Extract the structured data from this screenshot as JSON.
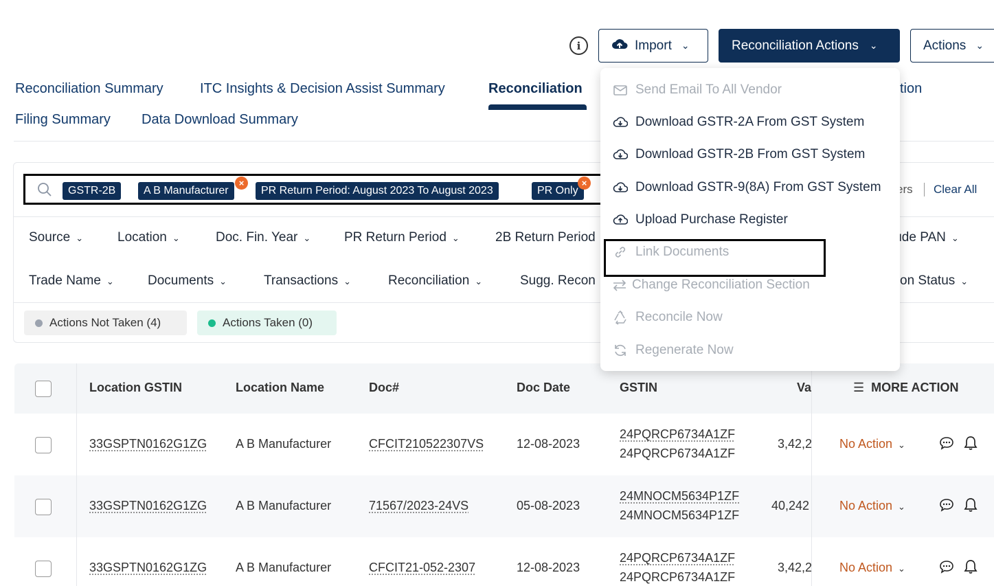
{
  "toolbar": {
    "info_glyph": "i",
    "import_label": "Import",
    "recon_actions_label": "Reconciliation Actions",
    "actions_label": "Actions"
  },
  "tabs": [
    {
      "label": "Reconciliation Summary"
    },
    {
      "label": "ITC Insights & Decision Assist Summary"
    },
    {
      "label": "Reconciliation",
      "active": true
    },
    {
      "label": "tion"
    },
    {
      "label": "Filing Summary"
    },
    {
      "label": "Data Download Summary"
    }
  ],
  "filters": {
    "chips": [
      "GSTR-2B",
      "A B Manufacturer",
      "PR Return Period: August 2023 To August 2023",
      "PR Only"
    ],
    "chip_remove_glyph": "×",
    "ers_text": "ers",
    "clear_all": "Clear All",
    "row1": [
      "Source",
      "Location",
      "Doc. Fin. Year",
      "PR Return Period",
      "2B Return Period",
      "lude PAN"
    ],
    "row2": [
      "Trade Name",
      "Documents",
      "Transactions",
      "Reconciliation",
      "Sugg. Recon",
      "on Status"
    ]
  },
  "action_pills": {
    "not_taken": "Actions Not Taken (4)",
    "taken": "Actions Taken (0)"
  },
  "table": {
    "headers": {
      "location_gstin": "Location GSTIN",
      "location_name": "Location Name",
      "doc_no": "Doc#",
      "doc_date": "Doc Date",
      "gstin": "GSTIN",
      "value": "Va",
      "more_action": "MORE ACTION"
    },
    "rows": [
      {
        "location_gstin": "33GSPTN0162G1ZG",
        "location_name": "A B Manufacturer",
        "doc_no": "CFCIT210522307VS",
        "doc_date": "12-08-2023",
        "gstin_1": "24PQRCP6734A1ZF",
        "gstin_2": "24PQRCP6734A1ZF",
        "value": "3,42,2",
        "action": "No Action"
      },
      {
        "location_gstin": "33GSPTN0162G1ZG",
        "location_name": "A B Manufacturer",
        "doc_no": "71567/2023-24VS",
        "doc_date": "05-08-2023",
        "gstin_1": "24MNOCM5634P1ZF",
        "gstin_2": "24MNOCM5634P1ZF",
        "value": "40,242",
        "action": "No Action"
      },
      {
        "location_gstin": "33GSPTN0162G1ZG",
        "location_name": "A B Manufacturer",
        "doc_no": "CFCIT21-052-2307",
        "doc_date": "12-08-2023",
        "gstin_1": "24PQRCP6734A1ZF",
        "gstin_2": "24PQRCP6734A1ZF",
        "value": "3,42,2",
        "action": "No Action"
      }
    ]
  },
  "menu": {
    "items": [
      {
        "label": "Send Email To All Vendor",
        "icon": "mail-icon",
        "enabled": false
      },
      {
        "label": "Download GSTR-2A From GST System",
        "icon": "cloud-download-icon",
        "enabled": true
      },
      {
        "label": "Download GSTR-2B From GST System",
        "icon": "cloud-download-icon",
        "enabled": true
      },
      {
        "label": "Download GSTR-9(8A) From GST System",
        "icon": "cloud-download-icon",
        "enabled": true
      },
      {
        "label": "Upload Purchase Register",
        "icon": "cloud-upload-icon",
        "enabled": true
      },
      {
        "label": "Link Documents",
        "icon": "link-icon",
        "enabled": false
      },
      {
        "label": "Change Reconciliation Section",
        "icon": "swap-icon",
        "enabled": false
      },
      {
        "label": "Reconcile Now",
        "icon": "recycle-icon",
        "enabled": false
      },
      {
        "label": "Regenerate Now",
        "icon": "refresh-icon",
        "enabled": false
      }
    ]
  },
  "colors": {
    "brand_navy": "#0f2f57",
    "chip_remove": "#ec6a2b",
    "no_action": "#c0581f",
    "taken_dot": "#1abc8c"
  }
}
